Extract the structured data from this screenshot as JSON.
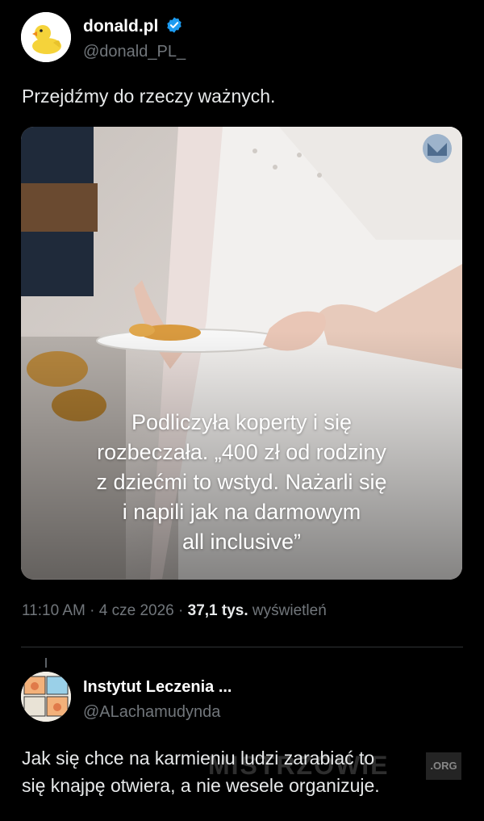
{
  "tweet": {
    "author_name": "donald.pl",
    "author_handle": "@donald_PL_",
    "verified": true,
    "text": "Przejdźmy do rzeczy ważnych.",
    "media_caption": "Podliczyła koperty i się\nrozbeczała. „400 zł od rodziny\nz dziećmi to wstyd. Nażarli się\ni napili jak na darmowym\nall inclusive”",
    "time": "11:10 AM",
    "date": "4 cze 2026",
    "views_count": "37,1 tys.",
    "views_label": "wyświetleń",
    "separator": "·"
  },
  "reply": {
    "author_name": "Instytut Leczenia ...",
    "author_handle": "@ALachamudynda",
    "text": "Jak się chce na karmieniu ludzi zarabiać to\nsię knajpę otwiera, a nie wesele organizuje."
  },
  "watermark": {
    "text": "MISTRZOWIE",
    "suffix": ".ORG"
  },
  "colors": {
    "background": "#000000",
    "text": "#e7e9ea",
    "secondary_text": "#71767b",
    "verified_badge": "#1d9bf0",
    "divider": "#2f3336"
  },
  "icons": {
    "verified": "verified-badge-icon",
    "media_logo": "media-logo-icon"
  }
}
